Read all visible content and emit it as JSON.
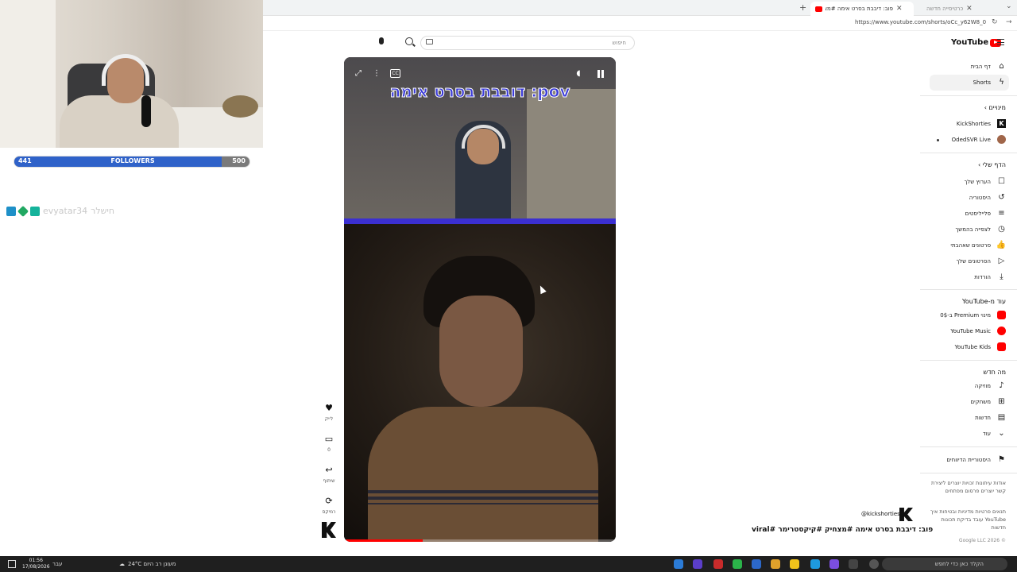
{
  "browser": {
    "active_tab_title": "פוב: דיבבת בסרט אימה #מצחיק",
    "inactive_tab_title": "כרטיסייה חדשה",
    "url": "https://www.youtube.com/shorts/oCc_y62W8_0"
  },
  "overlay": {
    "followers_current": "441",
    "followers_label": "FOLLOWERS",
    "followers_goal": "500",
    "followers_progress": 0.882,
    "chat_user": "evyatar34",
    "chat_message": "חישלר"
  },
  "youtube": {
    "logo": "YouTube",
    "search_placeholder": "חיפוש"
  },
  "video": {
    "caption": "דובבת בסרט אימה :pov",
    "progress": 0.29,
    "channel_handle": "@kickshorties",
    "title": "פוב: דיבבת בסרט אימה #מצחיק #קיקסטרימר #viral"
  },
  "actions": {
    "like_label": "לייק",
    "comment_count": "0",
    "share_label": "שיתוף",
    "remix_label": "רמיקס"
  },
  "sidebar": {
    "home": "דף הבית",
    "shorts": "Shorts",
    "subscriptions_heading": "מינויים",
    "sub1": "KickShorties",
    "sub2": "OdedSVR Live",
    "you_heading": "הדף שלי",
    "you_items": [
      "הערוץ שלך",
      "היסטוריה",
      "פלייליסטים",
      "לצפייה בהמשך",
      "סרטונים שאהבתי",
      "הסרטונים שלך",
      "הורדות"
    ],
    "more_from_heading": "עוד מ-YouTube",
    "more_from": [
      "מינוי Premium ב-0$",
      "YouTube Music",
      "YouTube Kids"
    ],
    "explore_heading": "מה חדש",
    "explore": [
      "מוזיקה",
      "משחקים",
      "חדשות",
      "עוד"
    ],
    "report_history": "היסטוריית הדיווחים",
    "footer1": "אודות עיתונות זכויות יוצרים ליצירת קשר יוצרים פרסום מפתחים",
    "footer2": "תנאים פרטיות מדיניות ובטיחות איך YouTube עובד בדיקת תכונות חדשות",
    "copyright": "© 2026 Google LLC"
  },
  "taskbar": {
    "time": "01:56",
    "date": "17/08/2026",
    "lang": "עבר",
    "weather": "24°C מעונן רב היום",
    "search": "הקלד כאן כדי לחפש"
  }
}
